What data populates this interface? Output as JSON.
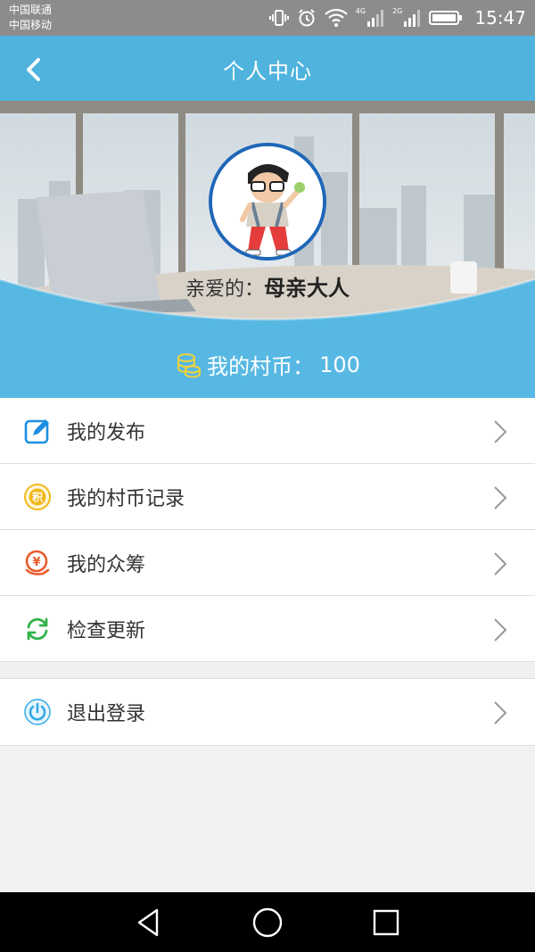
{
  "status_bar": {
    "carrier_1": "中国联通",
    "carrier_2": "中国移动",
    "net_1": "4G",
    "net_2": "2G",
    "time": "15:47"
  },
  "app_bar": {
    "title": "个人中心",
    "back_icon": "chevron-left-icon"
  },
  "profile": {
    "greeting_prefix": "亲爱的：",
    "username": "母亲大人",
    "coins_label": "我的村币：",
    "coins_value": "100",
    "coins_icon": "coin-stack-icon"
  },
  "menu": [
    {
      "label": "我的发布",
      "icon": "edit-icon",
      "color": "#1e8fe3"
    },
    {
      "label": "我的村币记录",
      "icon": "points-coin-icon",
      "color": "#f2b81b"
    },
    {
      "label": "我的众筹",
      "icon": "crowdfund-yen-icon",
      "color": "#ea5b2b"
    },
    {
      "label": "检查更新",
      "icon": "refresh-icon",
      "color": "#32b34a"
    }
  ],
  "logout": {
    "label": "退出登录",
    "icon": "power-icon",
    "color": "#33a9e6"
  },
  "colors": {
    "primary": "#4fb3de",
    "header": "#57b8e3",
    "avatar_border": "#1f67b8"
  },
  "nav": {
    "back": "triangle-back-icon",
    "home": "circle-home-icon",
    "recents": "square-recents-icon"
  }
}
